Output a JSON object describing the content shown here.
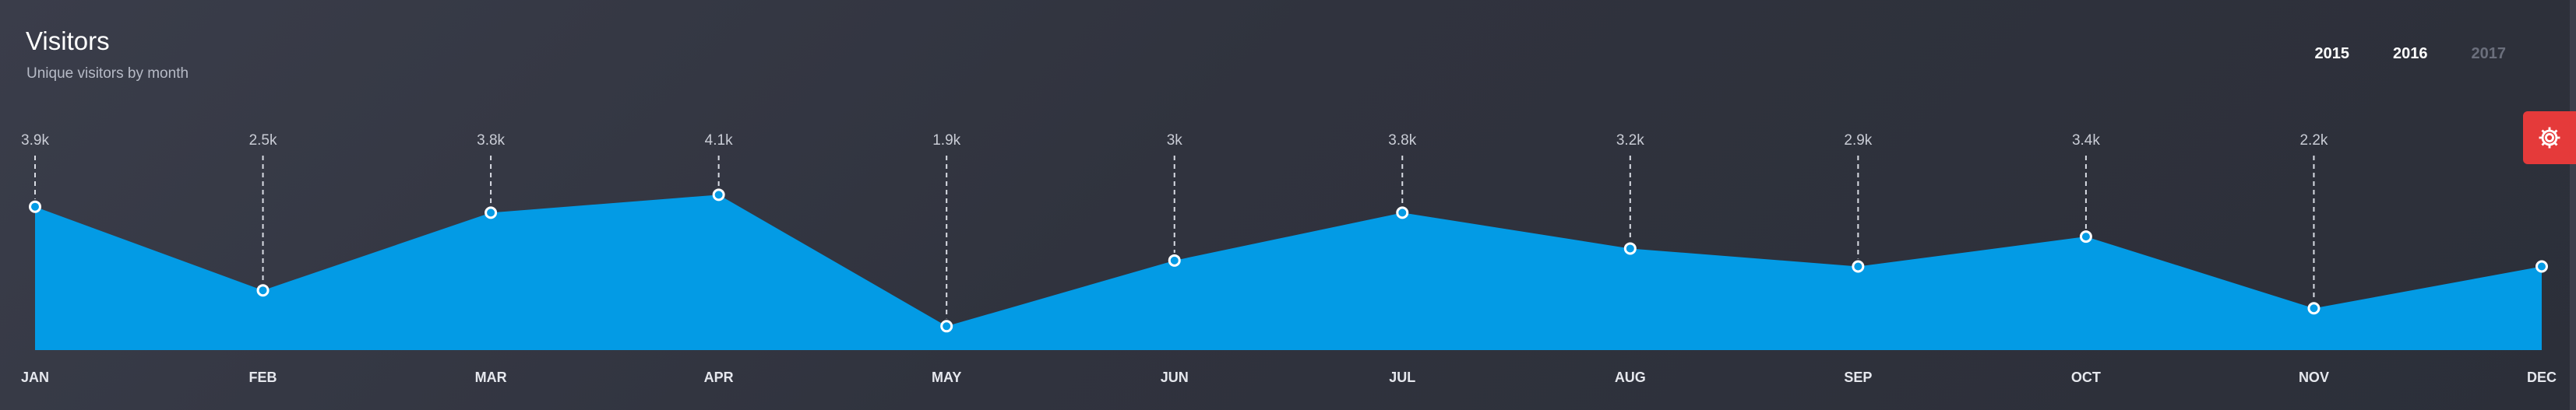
{
  "header": {
    "title": "Visitors",
    "subtitle": "Unique visitors by month"
  },
  "years": [
    {
      "label": "2015",
      "active": true
    },
    {
      "label": "2016",
      "active": true
    },
    {
      "label": "2017",
      "active": false
    }
  ],
  "settings_icon": "gear-icon",
  "colors": {
    "area": "#039be5",
    "background": "#30333e",
    "settings_button": "#e53a3a"
  },
  "chart_data": {
    "type": "area",
    "categories": [
      "JAN",
      "FEB",
      "MAR",
      "APR",
      "MAY",
      "JUN",
      "JUL",
      "AUG",
      "SEP",
      "OCT",
      "NOV",
      "DEC"
    ],
    "series": [
      {
        "values": [
          3.9,
          2.5,
          3.8,
          4.1,
          1.9,
          3.0,
          3.8,
          3.2,
          2.9,
          3.4,
          2.2,
          2.9
        ]
      }
    ],
    "value_labels": [
      "3.9k",
      "2.5k",
      "3.8k",
      "4.1k",
      "1.9k",
      "3k",
      "3.8k",
      "3.2k",
      "2.9k",
      "3.4k",
      "2.2k",
      ""
    ],
    "ylim": [
      1.5,
      4.3
    ],
    "grid": false
  }
}
